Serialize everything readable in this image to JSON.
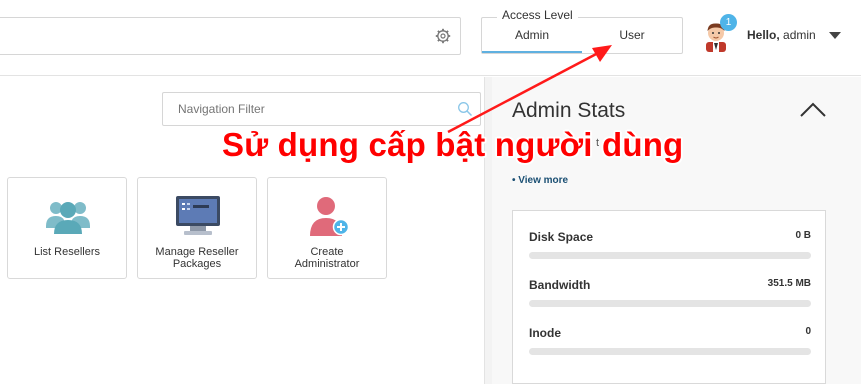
{
  "header": {
    "access_level": {
      "legend": "Access Level",
      "admin_label": "Admin",
      "user_label": "User",
      "active": "Admin"
    },
    "notification_count": "1",
    "greeting_prefix": "Hello,",
    "username": "admin"
  },
  "main": {
    "nav_filter_placeholder": "Navigation Filter",
    "tiles": [
      {
        "label": "List Resellers"
      },
      {
        "label_line1": "Manage Reseller",
        "label_line2": "Packages"
      },
      {
        "label_line1": "Create",
        "label_line2": "Administrator"
      }
    ]
  },
  "stats": {
    "title": "Admin Stats",
    "subtitle_fragment": "t",
    "view_more": "• View more",
    "items": [
      {
        "name": "Disk Space",
        "value": "0 B"
      },
      {
        "name": "Bandwidth",
        "value": "351.5 MB"
      },
      {
        "name": "Inode",
        "value": "0"
      }
    ]
  },
  "annotation": {
    "text": "Sử dụng cấp bật người dùng",
    "color": "#ff0000"
  },
  "colors": {
    "accent": "#5fb0e0",
    "badge": "#4fb4e8",
    "icon_teal": "#5aa9b8",
    "icon_pink": "#e06a7a"
  }
}
